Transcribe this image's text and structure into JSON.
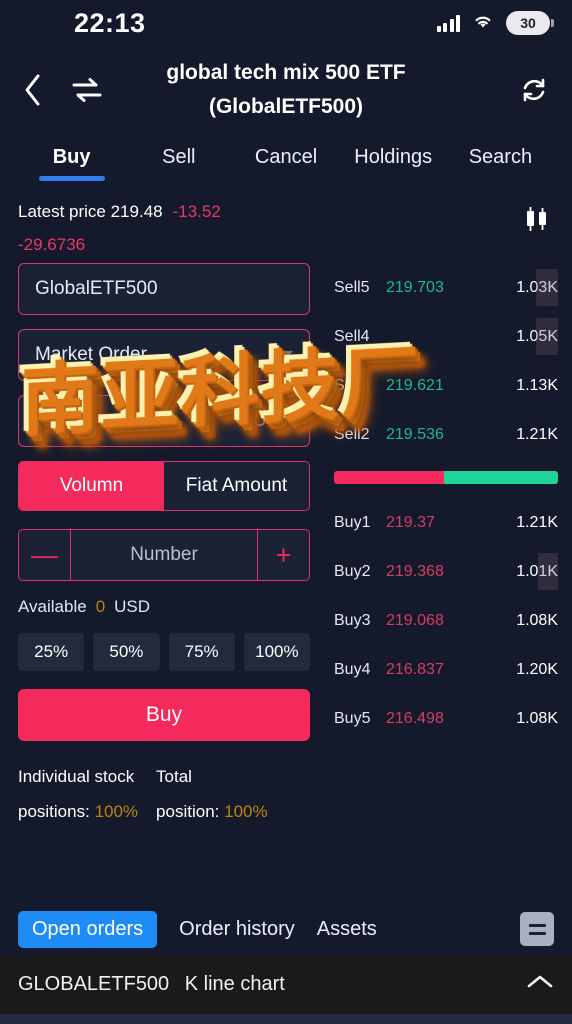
{
  "status_bar": {
    "time": "22:13",
    "battery_level": "30",
    "signal_icon": "signal-bars-icon",
    "wifi_icon": "wifi-icon"
  },
  "header": {
    "back_icon": "chevron-left-icon",
    "swap_icon": "swap-arrows-icon",
    "refresh_icon": "refresh-icon",
    "title_line1": "global tech mix 500 ETF",
    "title_line2": "(GlobalETF500)"
  },
  "tabs": [
    {
      "label": "Buy",
      "active": true
    },
    {
      "label": "Sell",
      "active": false
    },
    {
      "label": "Cancel",
      "active": false
    },
    {
      "label": "Holdings",
      "active": false
    },
    {
      "label": "Search",
      "active": false
    }
  ],
  "price": {
    "latest_label": "Latest price 219.48",
    "change": "-13.52",
    "change_percent": "-29.6736",
    "chart_icon": "candlestick-icon"
  },
  "order_form": {
    "symbol_value": "GlobalETF500",
    "order_type_value": "Market Order",
    "price_value": "219.48",
    "price_unit": "USD",
    "toggle_volume": "Volumn",
    "toggle_fiat": "Fiat Amount",
    "minus_label": "—",
    "plus_label": "+",
    "number_placeholder": "Number",
    "available_label": "Available",
    "available_value": "0",
    "available_currency": "USD",
    "percents": [
      "25%",
      "50%",
      "75%",
      "100%"
    ],
    "submit_label": "Buy",
    "individual_label": "Individual stock",
    "individual_value_label": "positions:",
    "individual_value": "100%",
    "total_label": "Total",
    "total_value_label": "position:",
    "total_value": "100%"
  },
  "order_book": {
    "sells": [
      {
        "label": "Sell5",
        "price": "219.703",
        "qty": "1.03K",
        "bar_pct": 10
      },
      {
        "label": "Sell4",
        "price": "",
        "qty": "1.05K",
        "bar_pct": 10
      },
      {
        "label": "Sell3",
        "price": "219.621",
        "qty": "1.13K",
        "bar_pct": 0
      },
      {
        "label": "Sell2",
        "price": "219.536",
        "qty": "1.21K",
        "bar_pct": 0
      }
    ],
    "depth": {
      "sell_pct": 49,
      "buy_pct": 51
    },
    "buys": [
      {
        "label": "Buy1",
        "price": "219.37",
        "qty": "1.21K",
        "bar_pct": 0
      },
      {
        "label": "Buy2",
        "price": "219.368",
        "qty": "1.01K",
        "bar_pct": 10
      },
      {
        "label": "Buy3",
        "price": "219.068",
        "qty": "1.08K",
        "bar_pct": 0
      },
      {
        "label": "Buy4",
        "price": "216.837",
        "qty": "1.20K",
        "bar_pct": 0
      },
      {
        "label": "Buy5",
        "price": "216.498",
        "qty": "1.08K",
        "bar_pct": 0
      }
    ]
  },
  "watermark": {
    "text": "南亚科技厂"
  },
  "bottom_tabs": [
    {
      "label": "Open orders",
      "active": true
    },
    {
      "label": "Order history",
      "active": false
    },
    {
      "label": "Assets",
      "active": false
    }
  ],
  "bottom_list_icon": "list-menu-icon",
  "footer": {
    "symbol": "GLOBALETF500",
    "label": "K line chart",
    "chevron_icon": "chevron-up-icon"
  },
  "colors": {
    "background": "#141a2b",
    "accent_pink": "#f4295c",
    "accent_blue": "#2f7ff0",
    "sell_green": "#1fb88a",
    "buy_red": "#d93b61",
    "gold": "#b8860b"
  }
}
